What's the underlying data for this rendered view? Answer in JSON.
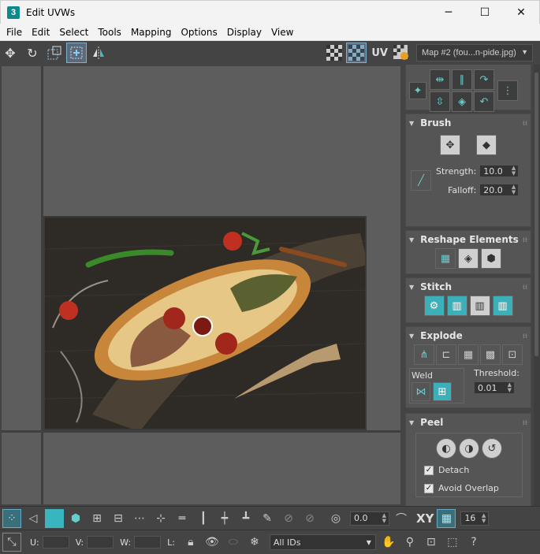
{
  "window": {
    "app_icon": "3",
    "title": "Edit UVWs",
    "minimize": "─",
    "maximize": "☐",
    "close": "✕"
  },
  "menu": [
    "File",
    "Edit",
    "Select",
    "Tools",
    "Mapping",
    "Options",
    "Display",
    "View"
  ],
  "toolbar": {
    "uv_label": "UV",
    "map_selected": "Map #2 (fou...n-pide.jpg)"
  },
  "panel": {
    "brush": {
      "title": "Brush",
      "strength_label": "Strength:",
      "strength_value": "10.0",
      "falloff_label": "Falloff:",
      "falloff_value": "20.0"
    },
    "reshape": {
      "title": "Reshape Elements"
    },
    "stitch": {
      "title": "Stitch"
    },
    "explode": {
      "title": "Explode",
      "weld_label": "Weld",
      "threshold_label": "Threshold:",
      "threshold_value": "0.01"
    },
    "peel": {
      "title": "Peel",
      "detach_label": "Detach",
      "detach_checked": true,
      "avoid_overlap_label": "Avoid Overlap",
      "avoid_overlap_checked": true
    }
  },
  "bottom": {
    "angle_value": "0.0",
    "xy_label": "XY",
    "grid_value": "16",
    "u_label": "U:",
    "v_label": "V:",
    "w_label": "W:",
    "l_label": "L:",
    "ids_selected": "All IDs"
  },
  "colors": {
    "accent_teal": "#39b5bf",
    "panel_bg": "#555555",
    "viewport_bg": "#5d5d5d"
  }
}
